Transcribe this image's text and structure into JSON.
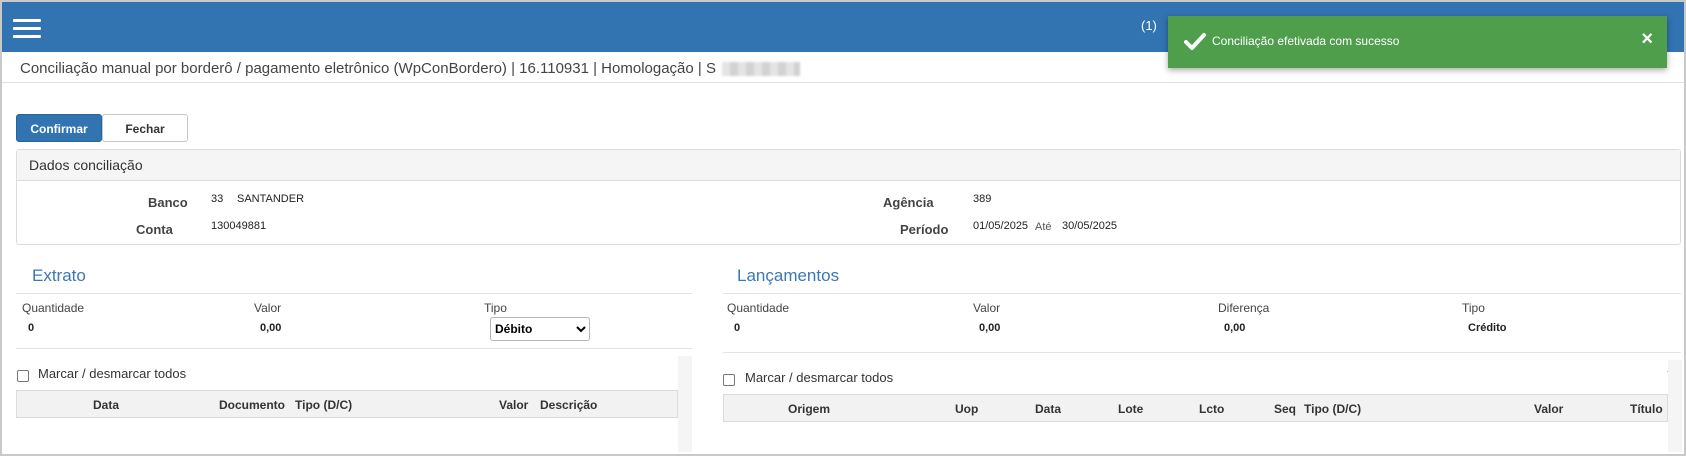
{
  "topbar": {
    "notif_count": "(1)"
  },
  "toast": {
    "message": "Conciliação efetivada com sucesso",
    "close": "×"
  },
  "page": {
    "title": "Conciliação manual por borderô / pagamento eletrônico (WpConBordero) | 16.110931 | Homologação | S"
  },
  "toolbar": {
    "confirm_label": "Confirmar",
    "close_label": "Fechar"
  },
  "dados": {
    "header": "Dados conciliação",
    "banco_label": "Banco",
    "banco_code": "33",
    "banco_name": "SANTANDER",
    "conta_label": "Conta",
    "conta_value": "130049881",
    "agencia_label": "Agência",
    "agencia_value": "389",
    "periodo_label": "Período",
    "periodo_from": "01/05/2025",
    "ate_label": "Até",
    "periodo_to": "30/05/2025"
  },
  "extrato": {
    "title": "Extrato",
    "quantidade_label": "Quantidade",
    "quantidade_value": "0",
    "valor_label": "Valor",
    "valor_value": "0,00",
    "tipo_label": "Tipo",
    "tipo_selected": "Débito",
    "marcar_label": "Marcar / desmarcar todos",
    "columns": [
      "Data",
      "Documento",
      "Tipo (D/C)",
      "Valor",
      "Descrição"
    ]
  },
  "lancamentos": {
    "title": "Lançamentos",
    "quantidade_label": "Quantidade",
    "quantidade_value": "0",
    "valor_label": "Valor",
    "valor_value": "0,00",
    "diferenca_label": "Diferença",
    "diferenca_value": "0,00",
    "tipo_label": "Tipo",
    "tipo_value": "Crédito",
    "marcar_label": "Marcar / desmarcar todos",
    "columns": [
      "Origem",
      "Uop",
      "Data",
      "Lote",
      "Lcto",
      "Seq",
      "Tipo (D/C)",
      "Valor",
      "Título"
    ]
  },
  "colors": {
    "brand": "#3273b1",
    "success": "#4f9e4c",
    "section_title": "#3a78b5"
  }
}
